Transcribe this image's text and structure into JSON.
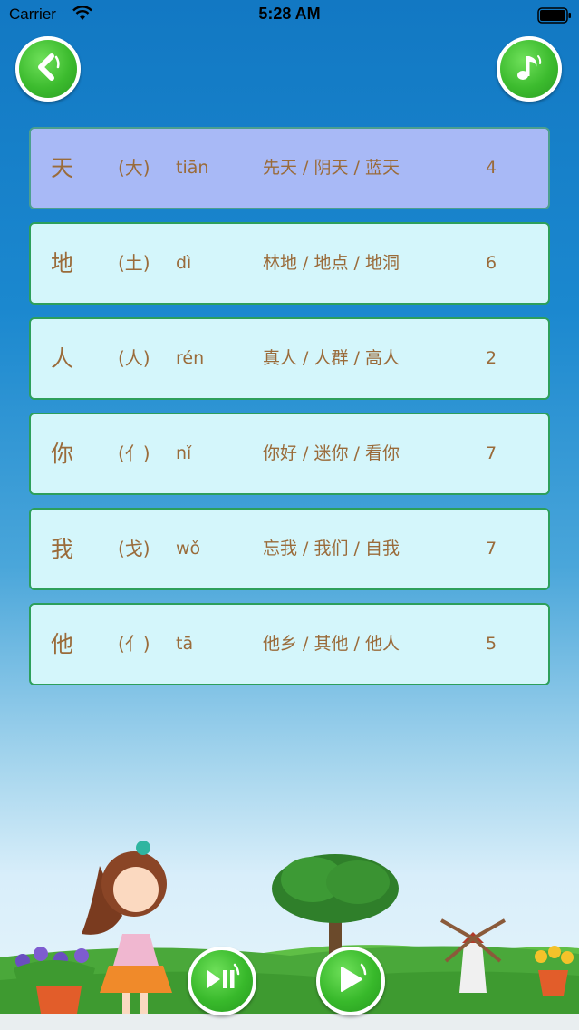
{
  "status_bar": {
    "carrier": "Carrier",
    "time": "5:28 AM"
  },
  "header": {
    "back_icon": "back-arrow-icon",
    "music_icon": "music-note-icon"
  },
  "rows": [
    {
      "char": "天",
      "radical": "(大)",
      "pinyin": "tiān",
      "words": "先天 / 阴天 / 蓝天",
      "strokes": "4",
      "selected": true
    },
    {
      "char": "地",
      "radical": "(土)",
      "pinyin": "dì",
      "words": "林地 / 地点 / 地洞",
      "strokes": "6"
    },
    {
      "char": "人",
      "radical": "(人)",
      "pinyin": "rén",
      "words": "真人 / 人群 / 高人",
      "strokes": "2"
    },
    {
      "char": "你",
      "radical": "(亻)",
      "pinyin": "nǐ",
      "words": "你好 / 迷你 / 看你",
      "strokes": "7"
    },
    {
      "char": "我",
      "radical": "(戈)",
      "pinyin": "wǒ",
      "words": "忘我 / 我们 / 自我",
      "strokes": "7"
    },
    {
      "char": "他",
      "radical": "(亻)",
      "pinyin": "tā",
      "words": "他乡 / 其他 / 他人",
      "strokes": "5"
    }
  ],
  "controls": {
    "play_pause_icon": "play-pause-icon",
    "play_icon": "play-icon"
  },
  "colors": {
    "row_bg": "#d4f6fb",
    "row_selected_bg": "#a8b9f6",
    "row_border": "#2d9f5b",
    "text": "#9a6b3a",
    "button_green": "#3cbb2e"
  }
}
